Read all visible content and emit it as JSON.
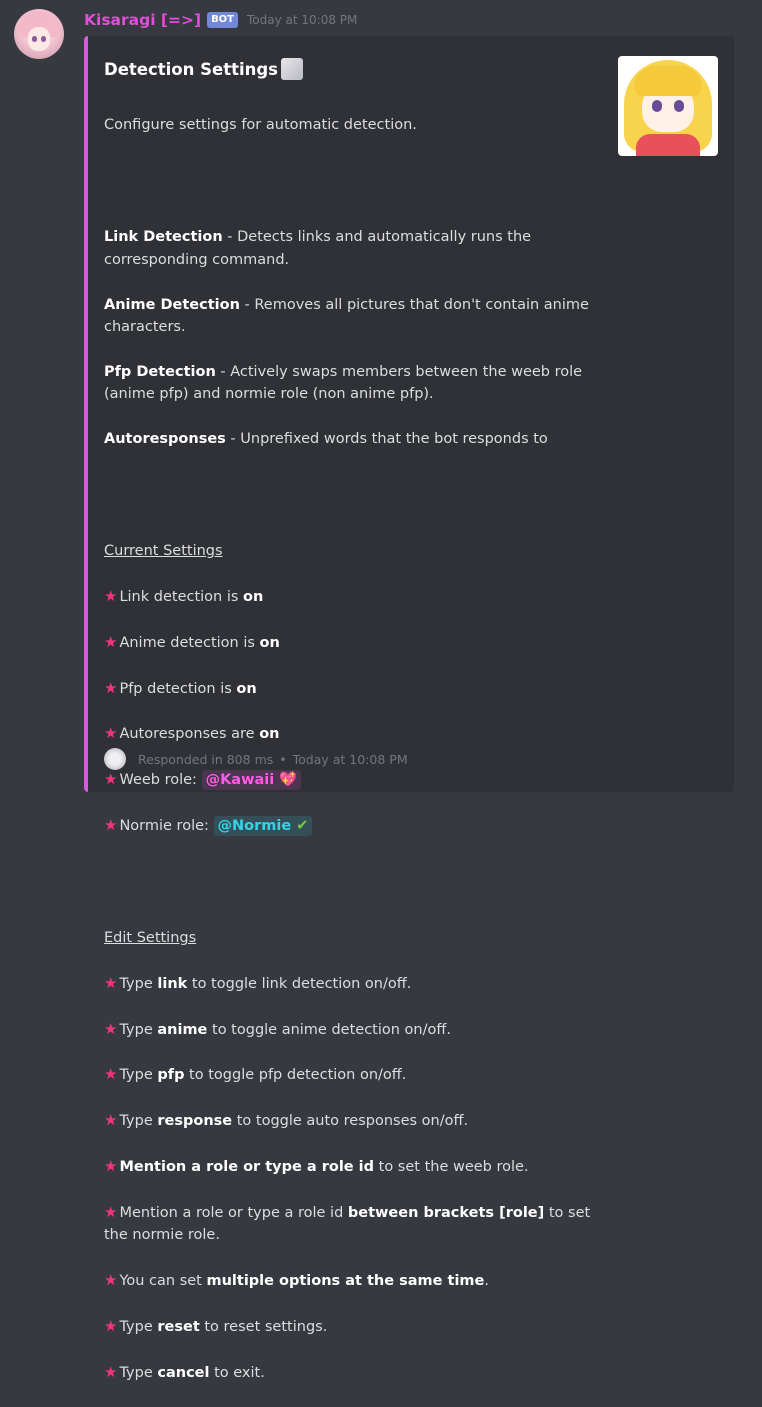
{
  "message": {
    "username": "Kisaragi [=>]",
    "bot_tag": "BOT",
    "timestamp": "Today at 10:08 PM",
    "avatar": "user-avatar-icon"
  },
  "embed": {
    "accent_color": "#d959dd",
    "title": "Detection Settings",
    "title_emoji": "anime-face-emoji-icon",
    "thumbnail": "anime-girl-thumbnail-icon",
    "intro": "Configure settings for automatic detection.",
    "features": [
      {
        "name": "Link Detection",
        "text": " - Detects links and automatically runs the corresponding command."
      },
      {
        "name": "Anime Detection",
        "text": " - Removes all pictures that don't contain anime characters."
      },
      {
        "name": "Pfp Detection",
        "text": " - Actively swaps members between the weeb role (anime pfp) and normie role (non anime pfp)."
      },
      {
        "name": "Autoresponses",
        "text": " - Unprefixed words that the bot responds to"
      }
    ],
    "current_header": "Current Settings",
    "current": {
      "link_prefix": "Link detection is ",
      "link_value": "on",
      "anime_prefix": "Anime detection is ",
      "anime_value": "on",
      "pfp_prefix": "Pfp detection is ",
      "pfp_value": "on",
      "auto_prefix": "Autoresponses are ",
      "auto_value": "on",
      "weeb_prefix": "Weeb role: ",
      "weeb_role": "@Kawaii",
      "weeb_emoji": "💖",
      "normie_prefix": "Normie role: ",
      "normie_role": "@Normie",
      "normie_emoji": "✔"
    },
    "edit_header": "Edit Settings",
    "edit": [
      {
        "pre": "Type ",
        "bold": "link",
        "post": " to toggle link detection on/off."
      },
      {
        "pre": "Type ",
        "bold": "anime",
        "post": " to toggle anime detection on/off."
      },
      {
        "pre": "Type ",
        "bold": "pfp",
        "post": " to toggle pfp detection on/off."
      },
      {
        "pre": "Type ",
        "bold": "response",
        "post": " to toggle auto responses on/off."
      },
      {
        "pre": "",
        "bold": "Mention a role or type a role id",
        "post": " to set the weeb role."
      },
      {
        "pre": "Mention a role or type a role id ",
        "bold": "between brackets [role]",
        "post": " to set the normie role."
      },
      {
        "pre": "You can set ",
        "bold": "multiple options at the same time",
        "post": "."
      },
      {
        "pre": "Type ",
        "bold": "reset",
        "post": " to reset settings."
      },
      {
        "pre": "Type ",
        "bold": "cancel",
        "post": " to exit."
      }
    ],
    "star_glyph": "★",
    "footer": {
      "icon": "bot-footer-icon",
      "text": "Responded in 808 ms",
      "separator": "•",
      "timestamp": "Today at 10:08 PM"
    }
  }
}
